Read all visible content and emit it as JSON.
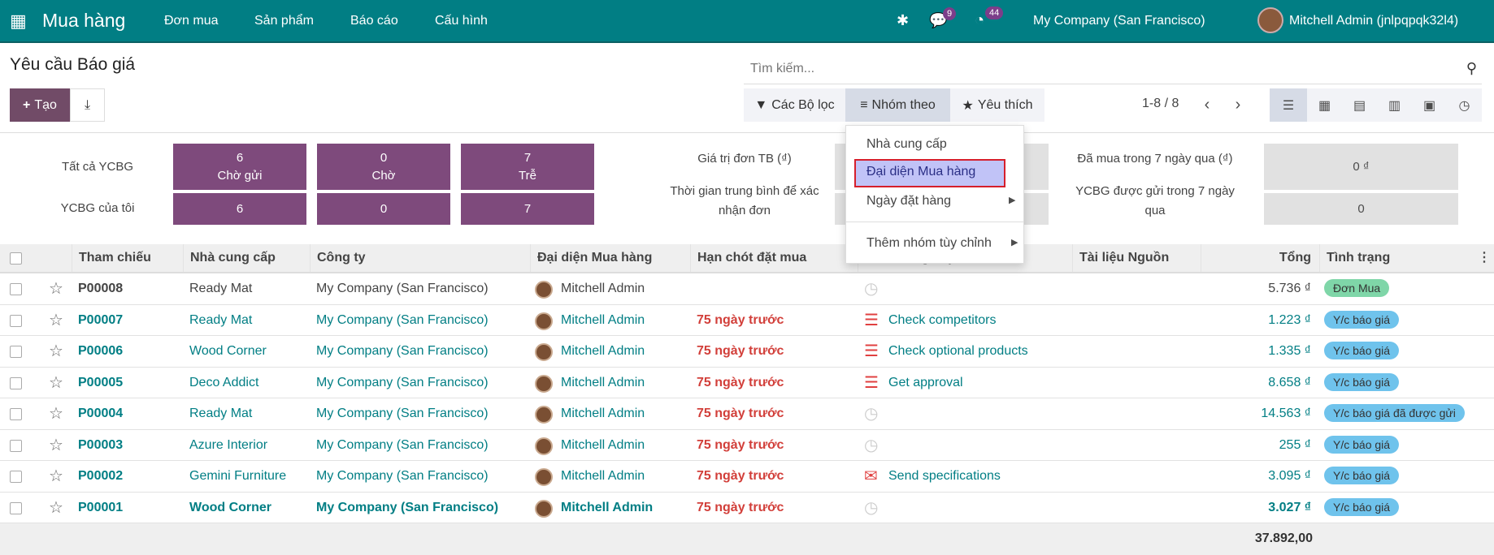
{
  "colors": {
    "navbar": "#017e84",
    "primary": "#714b67",
    "link": "#017e84",
    "danger": "#d23f3a",
    "badge_done": "#7fd6a8",
    "badge_rfq": "#6fc3ec"
  },
  "navbar": {
    "app_icon": "grid-icon",
    "app_name": "Mua hàng",
    "menus": [
      "Đơn mua",
      "Sản phẩm",
      "Báo cáo",
      "Cấu hình"
    ],
    "messages_count": "9",
    "activities_count": "44",
    "company": "My Company (San Francisco)",
    "user": "Mitchell Admin (jnlpqpqk32l4)"
  },
  "page": {
    "title": "Yêu cầu Báo giá",
    "create_label": "Tạo",
    "search_placeholder": "Tìm kiếm...",
    "filters_label": "Các Bộ lọc",
    "groupby_label": "Nhóm theo",
    "favorites_label": "Yêu thích",
    "pager": "1-8 / 8",
    "views": [
      "list",
      "kanban",
      "pivot",
      "graph",
      "calendar",
      "activity"
    ],
    "active_view": "list"
  },
  "groupby_menu": {
    "items": [
      "Nhà cung cấp",
      "Đại diện Mua hàng",
      "Ngày đặt hàng"
    ],
    "highlighted": "Đại diện Mua hàng",
    "custom": "Thêm nhóm tùy chỉnh"
  },
  "dashboard": {
    "all_label": "Tất cả YCBG",
    "mine_label": "YCBG của tôi",
    "all": [
      {
        "value": "6",
        "label": "Chờ gửi"
      },
      {
        "value": "0",
        "label": "Chờ"
      },
      {
        "value": "7",
        "label": "Trễ"
      }
    ],
    "mine": [
      "6",
      "0",
      "7"
    ],
    "avg_value_label": "Giá trị đơn TB (₫)",
    "lead_time_label": "Thời gian trung bình để xác nhận đơn",
    "purchased_label": "Đã mua trong 7 ngày qua (₫)",
    "purchased_value": "0 ₫",
    "sent_label": "YCBG được gửi trong 7 ngày qua",
    "sent_value": "0"
  },
  "table": {
    "columns": [
      "Tham chiếu",
      "Nhà cung cấp",
      "Công ty",
      "Đại diện Mua hàng",
      "Hạn chót đặt mua",
      "Hoạt động tiếp theo",
      "Tài liệu Nguồn",
      "Tổng",
      "Tình trạng"
    ],
    "rows": [
      {
        "ref": "P00008",
        "vendor": "Ready Mat",
        "company": "My Company (San Francisco)",
        "buyer": "Mitchell Admin",
        "deadline": "",
        "activity": "",
        "activity_icon": "clock-icon",
        "total": "5.736 ₫",
        "status": "Đơn Mua",
        "status_type": "done"
      },
      {
        "ref": "P00007",
        "vendor": "Ready Mat",
        "company": "My Company (San Francisco)",
        "buyer": "Mitchell Admin",
        "deadline": "75 ngày trước",
        "activity": "Check competitors",
        "activity_icon": "todo-icon",
        "total": "1.223 ₫",
        "status": "Y/c báo giá",
        "status_type": "rfq"
      },
      {
        "ref": "P00006",
        "vendor": "Wood Corner",
        "company": "My Company (San Francisco)",
        "buyer": "Mitchell Admin",
        "deadline": "75 ngày trước",
        "activity": "Check optional products",
        "activity_icon": "todo-icon",
        "total": "1.335 ₫",
        "status": "Y/c báo giá",
        "status_type": "rfq"
      },
      {
        "ref": "P00005",
        "vendor": "Deco Addict",
        "company": "My Company (San Francisco)",
        "buyer": "Mitchell Admin",
        "deadline": "75 ngày trước",
        "activity": "Get approval",
        "activity_icon": "todo-icon",
        "total": "8.658 ₫",
        "status": "Y/c báo giá",
        "status_type": "rfq"
      },
      {
        "ref": "P00004",
        "vendor": "Ready Mat",
        "company": "My Company (San Francisco)",
        "buyer": "Mitchell Admin",
        "deadline": "75 ngày trước",
        "activity": "",
        "activity_icon": "clock-icon",
        "total": "14.563 ₫",
        "status": "Y/c báo giá đã được gửi",
        "status_type": "rfq"
      },
      {
        "ref": "P00003",
        "vendor": "Azure Interior",
        "company": "My Company (San Francisco)",
        "buyer": "Mitchell Admin",
        "deadline": "75 ngày trước",
        "activity": "",
        "activity_icon": "clock-icon",
        "total": "255 ₫",
        "status": "Y/c báo giá",
        "status_type": "rfq"
      },
      {
        "ref": "P00002",
        "vendor": "Gemini Furniture",
        "company": "My Company (San Francisco)",
        "buyer": "Mitchell Admin",
        "deadline": "75 ngày trước",
        "activity": "Send specifications",
        "activity_icon": "email-icon",
        "total": "3.095 ₫",
        "status": "Y/c báo giá",
        "status_type": "rfq"
      },
      {
        "ref": "P00001",
        "vendor": "Wood Corner",
        "company": "My Company (San Francisco)",
        "buyer": "Mitchell Admin",
        "deadline": "75 ngày trước",
        "activity": "",
        "activity_icon": "clock-icon",
        "total": "3.027 ₫",
        "status": "Y/c báo giá",
        "status_type": "rfq",
        "bold": true
      }
    ],
    "footer_total": "37.892,00"
  }
}
